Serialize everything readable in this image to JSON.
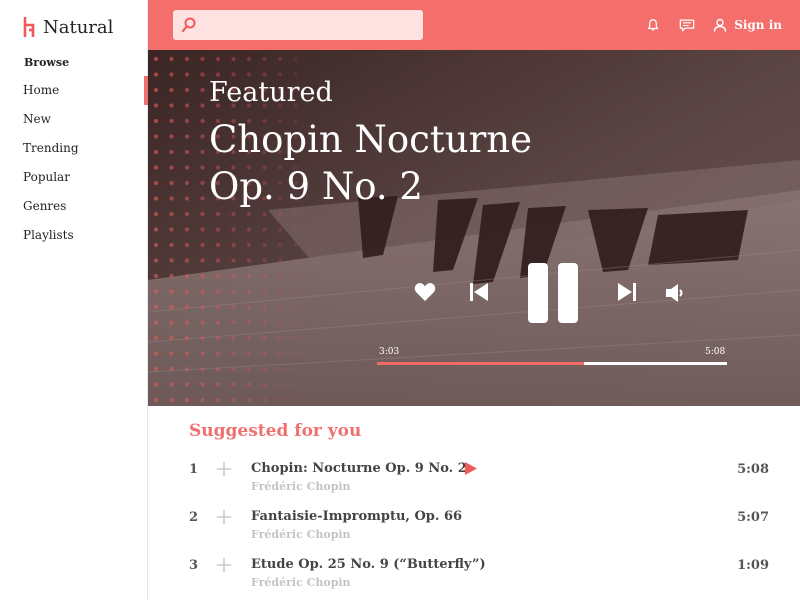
{
  "app": {
    "name": "Natural"
  },
  "sidebar": {
    "heading": "Browse",
    "items": [
      {
        "label": "Home",
        "active": true
      },
      {
        "label": "New",
        "active": false
      },
      {
        "label": "Trending",
        "active": false
      },
      {
        "label": "Popular",
        "active": false
      },
      {
        "label": "Genres",
        "active": false
      },
      {
        "label": "Playlists",
        "active": false
      }
    ]
  },
  "topbar": {
    "search_value": "",
    "icons": [
      "bell-icon",
      "chat-icon",
      "user-icon"
    ],
    "signin_label": "Sign in"
  },
  "hero": {
    "label": "Featured",
    "title_line1": "Chopin Nocturne",
    "title_line2": "Op. 9 No. 2",
    "time_current": "3:03",
    "time_total": "5:08",
    "progress_fraction": 0.59
  },
  "suggested": {
    "title": "Suggested for you",
    "tracks": [
      {
        "num": "1",
        "name": "Chopin: Nocturne Op. 9 No. 2",
        "artist": "Frédéric Chopin",
        "duration": "5:08",
        "playing": true
      },
      {
        "num": "2",
        "name": "Fantaisie-Impromptu, Op. 66",
        "artist": "Frédéric Chopin",
        "duration": "5:07",
        "playing": false
      },
      {
        "num": "3",
        "name": "Etude Op. 25 No. 9 (“Butterfly”)",
        "artist": "Frédéric Chopin",
        "duration": "1:09",
        "playing": false
      }
    ]
  },
  "colors": {
    "accent": "#f46e6c",
    "search_bg": "#fde2e1",
    "sidebar_active": "#f07070"
  }
}
